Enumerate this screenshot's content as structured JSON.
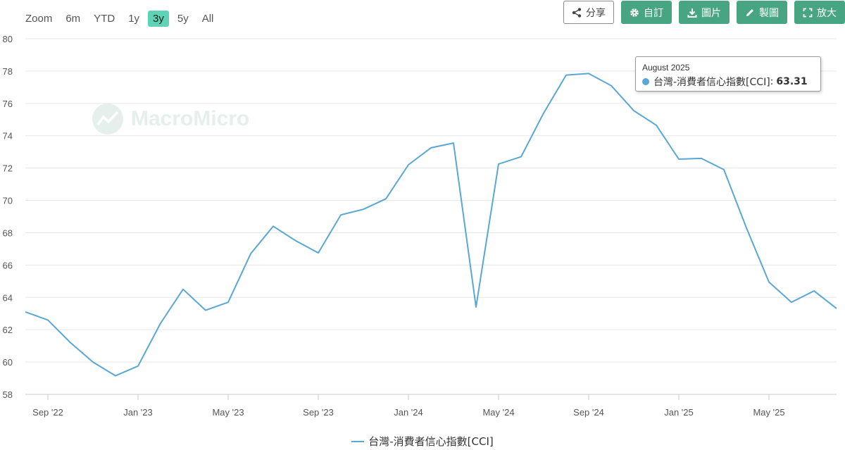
{
  "zoom": {
    "label": "Zoom",
    "options": [
      "6m",
      "YTD",
      "1y",
      "3y",
      "5y",
      "All"
    ],
    "active": "3y"
  },
  "toolbar": {
    "share_label": "分享",
    "custom_label": "自訂",
    "image_label": "圖片",
    "make_chart_label": "製圖",
    "fullscreen_label": "放大"
  },
  "watermark": {
    "text": "MacroMicro"
  },
  "tooltip": {
    "date": "August 2025",
    "series_name": "台灣-消費者信心指數[CCI]",
    "value": "63.31"
  },
  "colors": {
    "series": "#5aa7d4",
    "accent": "#48a583",
    "zoom_active": "#5fd3b5"
  },
  "chart_data": {
    "type": "line",
    "title": "",
    "xlabel": "",
    "ylabel": "",
    "ylim": [
      58,
      80
    ],
    "yticks": [
      58,
      60,
      62,
      64,
      66,
      68,
      70,
      72,
      74,
      76,
      78,
      80
    ],
    "xticks": [
      "Sep '22",
      "Jan '23",
      "May '23",
      "Sep '23",
      "Jan '24",
      "May '24",
      "Sep '24",
      "Jan '25",
      "May '25"
    ],
    "grid": true,
    "legend": "bottom-center",
    "series": [
      {
        "name": "台灣-消費者信心指數[CCI]",
        "x": [
          "2022-08",
          "2022-09",
          "2022-10",
          "2022-11",
          "2022-12",
          "2023-01",
          "2023-02",
          "2023-03",
          "2023-04",
          "2023-05",
          "2023-06",
          "2023-07",
          "2023-08",
          "2023-09",
          "2023-10",
          "2023-11",
          "2023-12",
          "2024-01",
          "2024-02",
          "2024-03",
          "2024-04",
          "2024-05",
          "2024-06",
          "2024-07",
          "2024-08",
          "2024-09",
          "2024-10",
          "2024-11",
          "2024-12",
          "2025-01",
          "2025-02",
          "2025-03",
          "2025-04",
          "2025-05",
          "2025-06",
          "2025-07",
          "2025-08"
        ],
        "values": [
          63.1,
          62.6,
          61.2,
          60.0,
          59.15,
          59.75,
          62.4,
          64.5,
          63.2,
          63.7,
          66.7,
          68.4,
          67.5,
          66.75,
          69.1,
          69.45,
          70.1,
          72.2,
          73.25,
          73.55,
          63.4,
          72.25,
          72.7,
          75.4,
          77.75,
          77.85,
          77.1,
          75.55,
          74.65,
          72.55,
          72.6,
          71.9,
          68.3,
          64.95,
          63.7,
          64.4,
          63.31
        ]
      }
    ]
  }
}
